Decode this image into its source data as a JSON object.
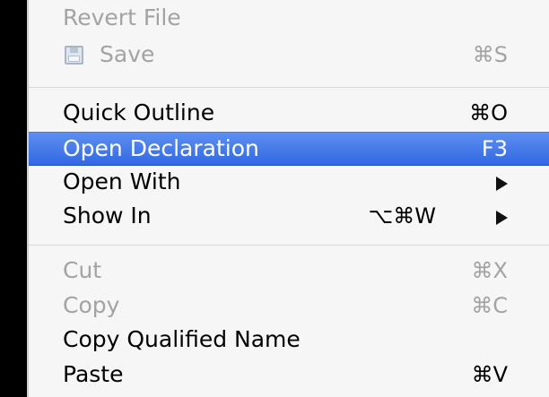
{
  "menu": {
    "items": [
      {
        "label": "Revert File",
        "shortcut": "",
        "enabled": false
      },
      {
        "label": "Save",
        "shortcut": "⌘S",
        "enabled": false,
        "icon": "save-icon"
      },
      {
        "label": "Quick Outline",
        "shortcut": "⌘O",
        "enabled": true
      },
      {
        "label": "Open Declaration",
        "shortcut": "F3",
        "enabled": true,
        "selected": true
      },
      {
        "label": "Open With",
        "shortcut": "",
        "enabled": true,
        "submenu": true
      },
      {
        "label": "Show In",
        "shortcut": "⌥⌘W",
        "enabled": true,
        "submenu": true
      },
      {
        "label": "Cut",
        "shortcut": "⌘X",
        "enabled": false
      },
      {
        "label": "Copy",
        "shortcut": "⌘C",
        "enabled": false
      },
      {
        "label": "Copy Qualified Name",
        "shortcut": "",
        "enabled": true
      },
      {
        "label": "Paste",
        "shortcut": "⌘V",
        "enabled": true
      }
    ],
    "selection_color": "#3b6fe6"
  }
}
